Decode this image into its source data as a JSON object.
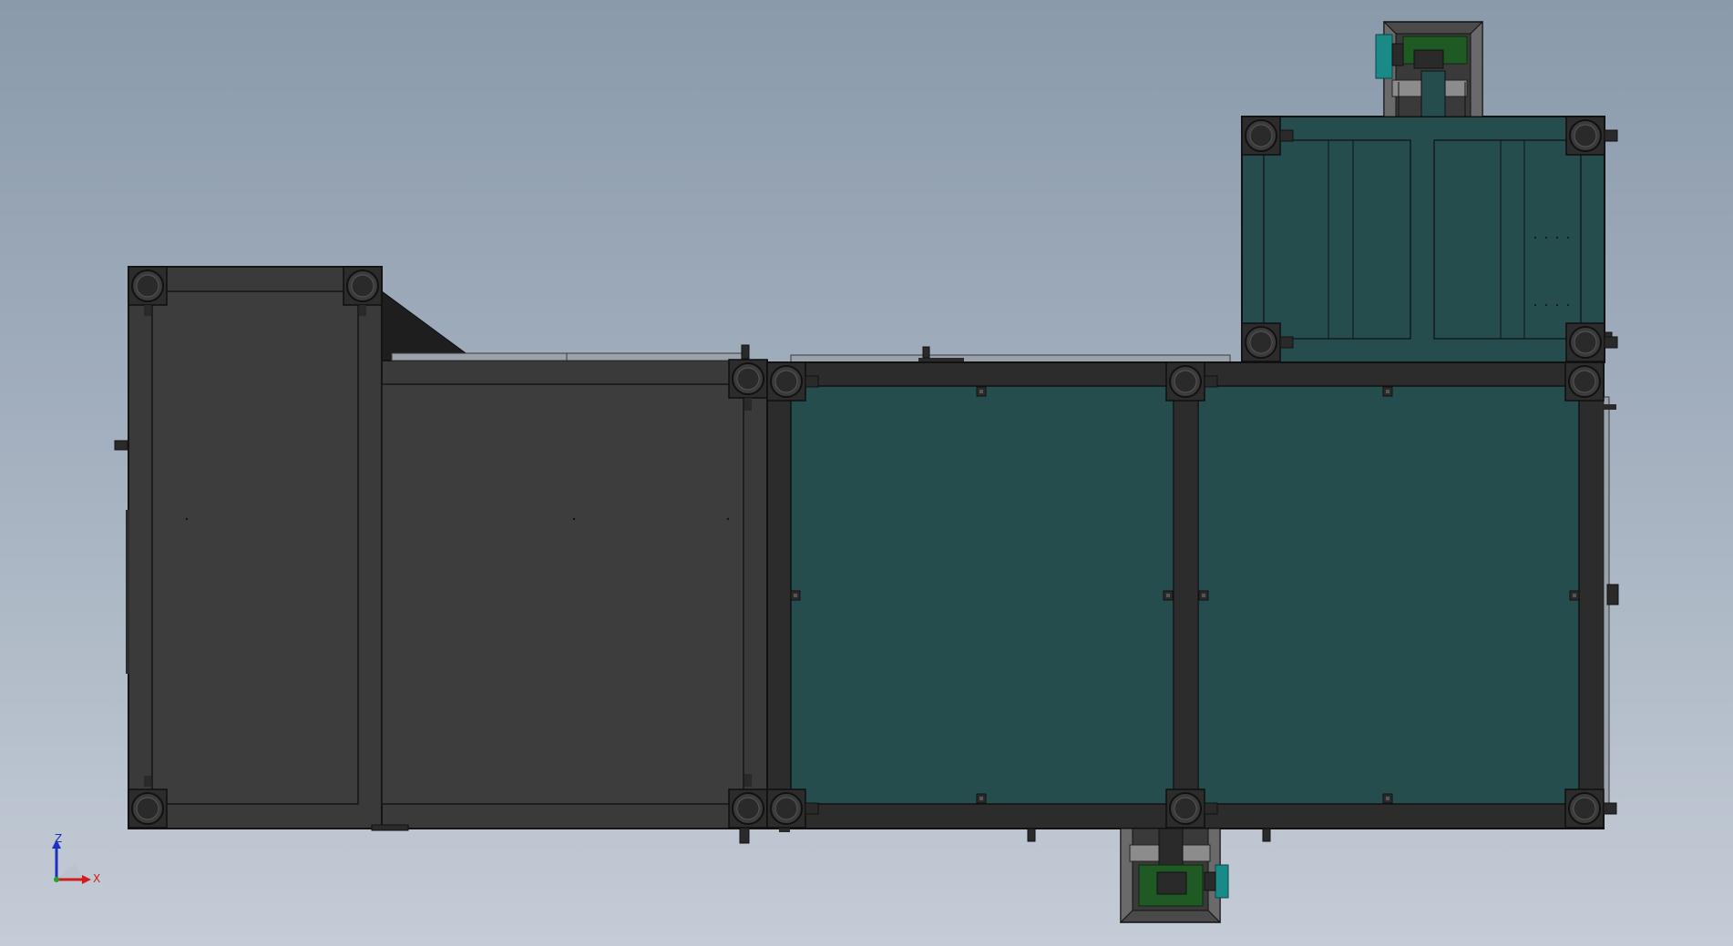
{
  "viewport": {
    "background": [
      "#8a9aab",
      "#c4ccd6"
    ],
    "colors": {
      "dark_frame": "#3a3a3a",
      "frame_outline": "#151515",
      "teal_panel": "#254d4e",
      "teal_dark": "#1d3f40",
      "caster": "#2e2e2e",
      "pcb_green": "#1f5a24",
      "steel": "#8c8c8c",
      "cyan_motor": "#1a8a88"
    }
  },
  "model": {
    "name": "",
    "icon": "conveyor-assembly-top-view"
  },
  "triad": {
    "axis_z_label": "Z",
    "axis_x_label": "X",
    "z_color": "#1f2fbf",
    "x_color": "#d21b1b",
    "y_color": "#2aa02a"
  }
}
